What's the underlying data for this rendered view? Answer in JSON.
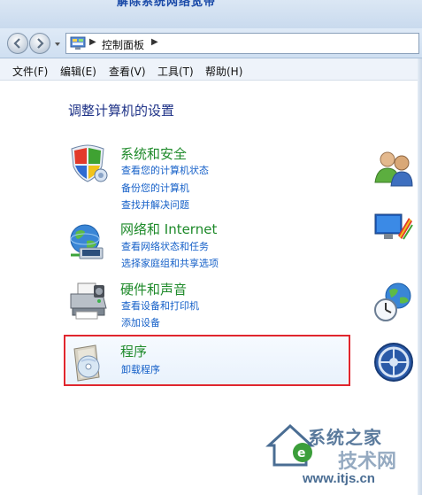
{
  "window": {
    "top_cutoff_text": "解除系统网络宽带"
  },
  "navigation": {
    "address_breadcrumb": "控制面板"
  },
  "menu": {
    "items": [
      "文件(F)",
      "编辑(E)",
      "查看(V)",
      "工具(T)",
      "帮助(H)"
    ]
  },
  "main": {
    "title": "调整计算机的设置",
    "categories": [
      {
        "title": "系统和安全",
        "icon": "shield-icon",
        "links": [
          "查看您的计算机状态",
          "备份您的计算机",
          "查找并解决问题"
        ]
      },
      {
        "title": "网络和 Internet",
        "icon": "network-globe-icon",
        "links": [
          "查看网络状态和任务",
          "选择家庭组和共享选项"
        ]
      },
      {
        "title": "硬件和声音",
        "icon": "printer-icon",
        "links": [
          "查看设备和打印机",
          "添加设备"
        ]
      },
      {
        "title": "程序",
        "icon": "programs-disc-icon",
        "links": [
          "卸载程序"
        ],
        "highlighted": true
      }
    ],
    "side_icons": [
      "user-accounts-icon",
      "appearance-icon",
      "clock-globe-icon",
      "ease-of-access-icon"
    ]
  },
  "colors": {
    "category_title": "#1e8a2a",
    "link": "#1560c8",
    "page_title": "#1e3287",
    "highlight_border": "#e0262e"
  },
  "watermark": {
    "line1": "系统之家",
    "line2": "技术网",
    "url": "www.itjs.cn"
  }
}
